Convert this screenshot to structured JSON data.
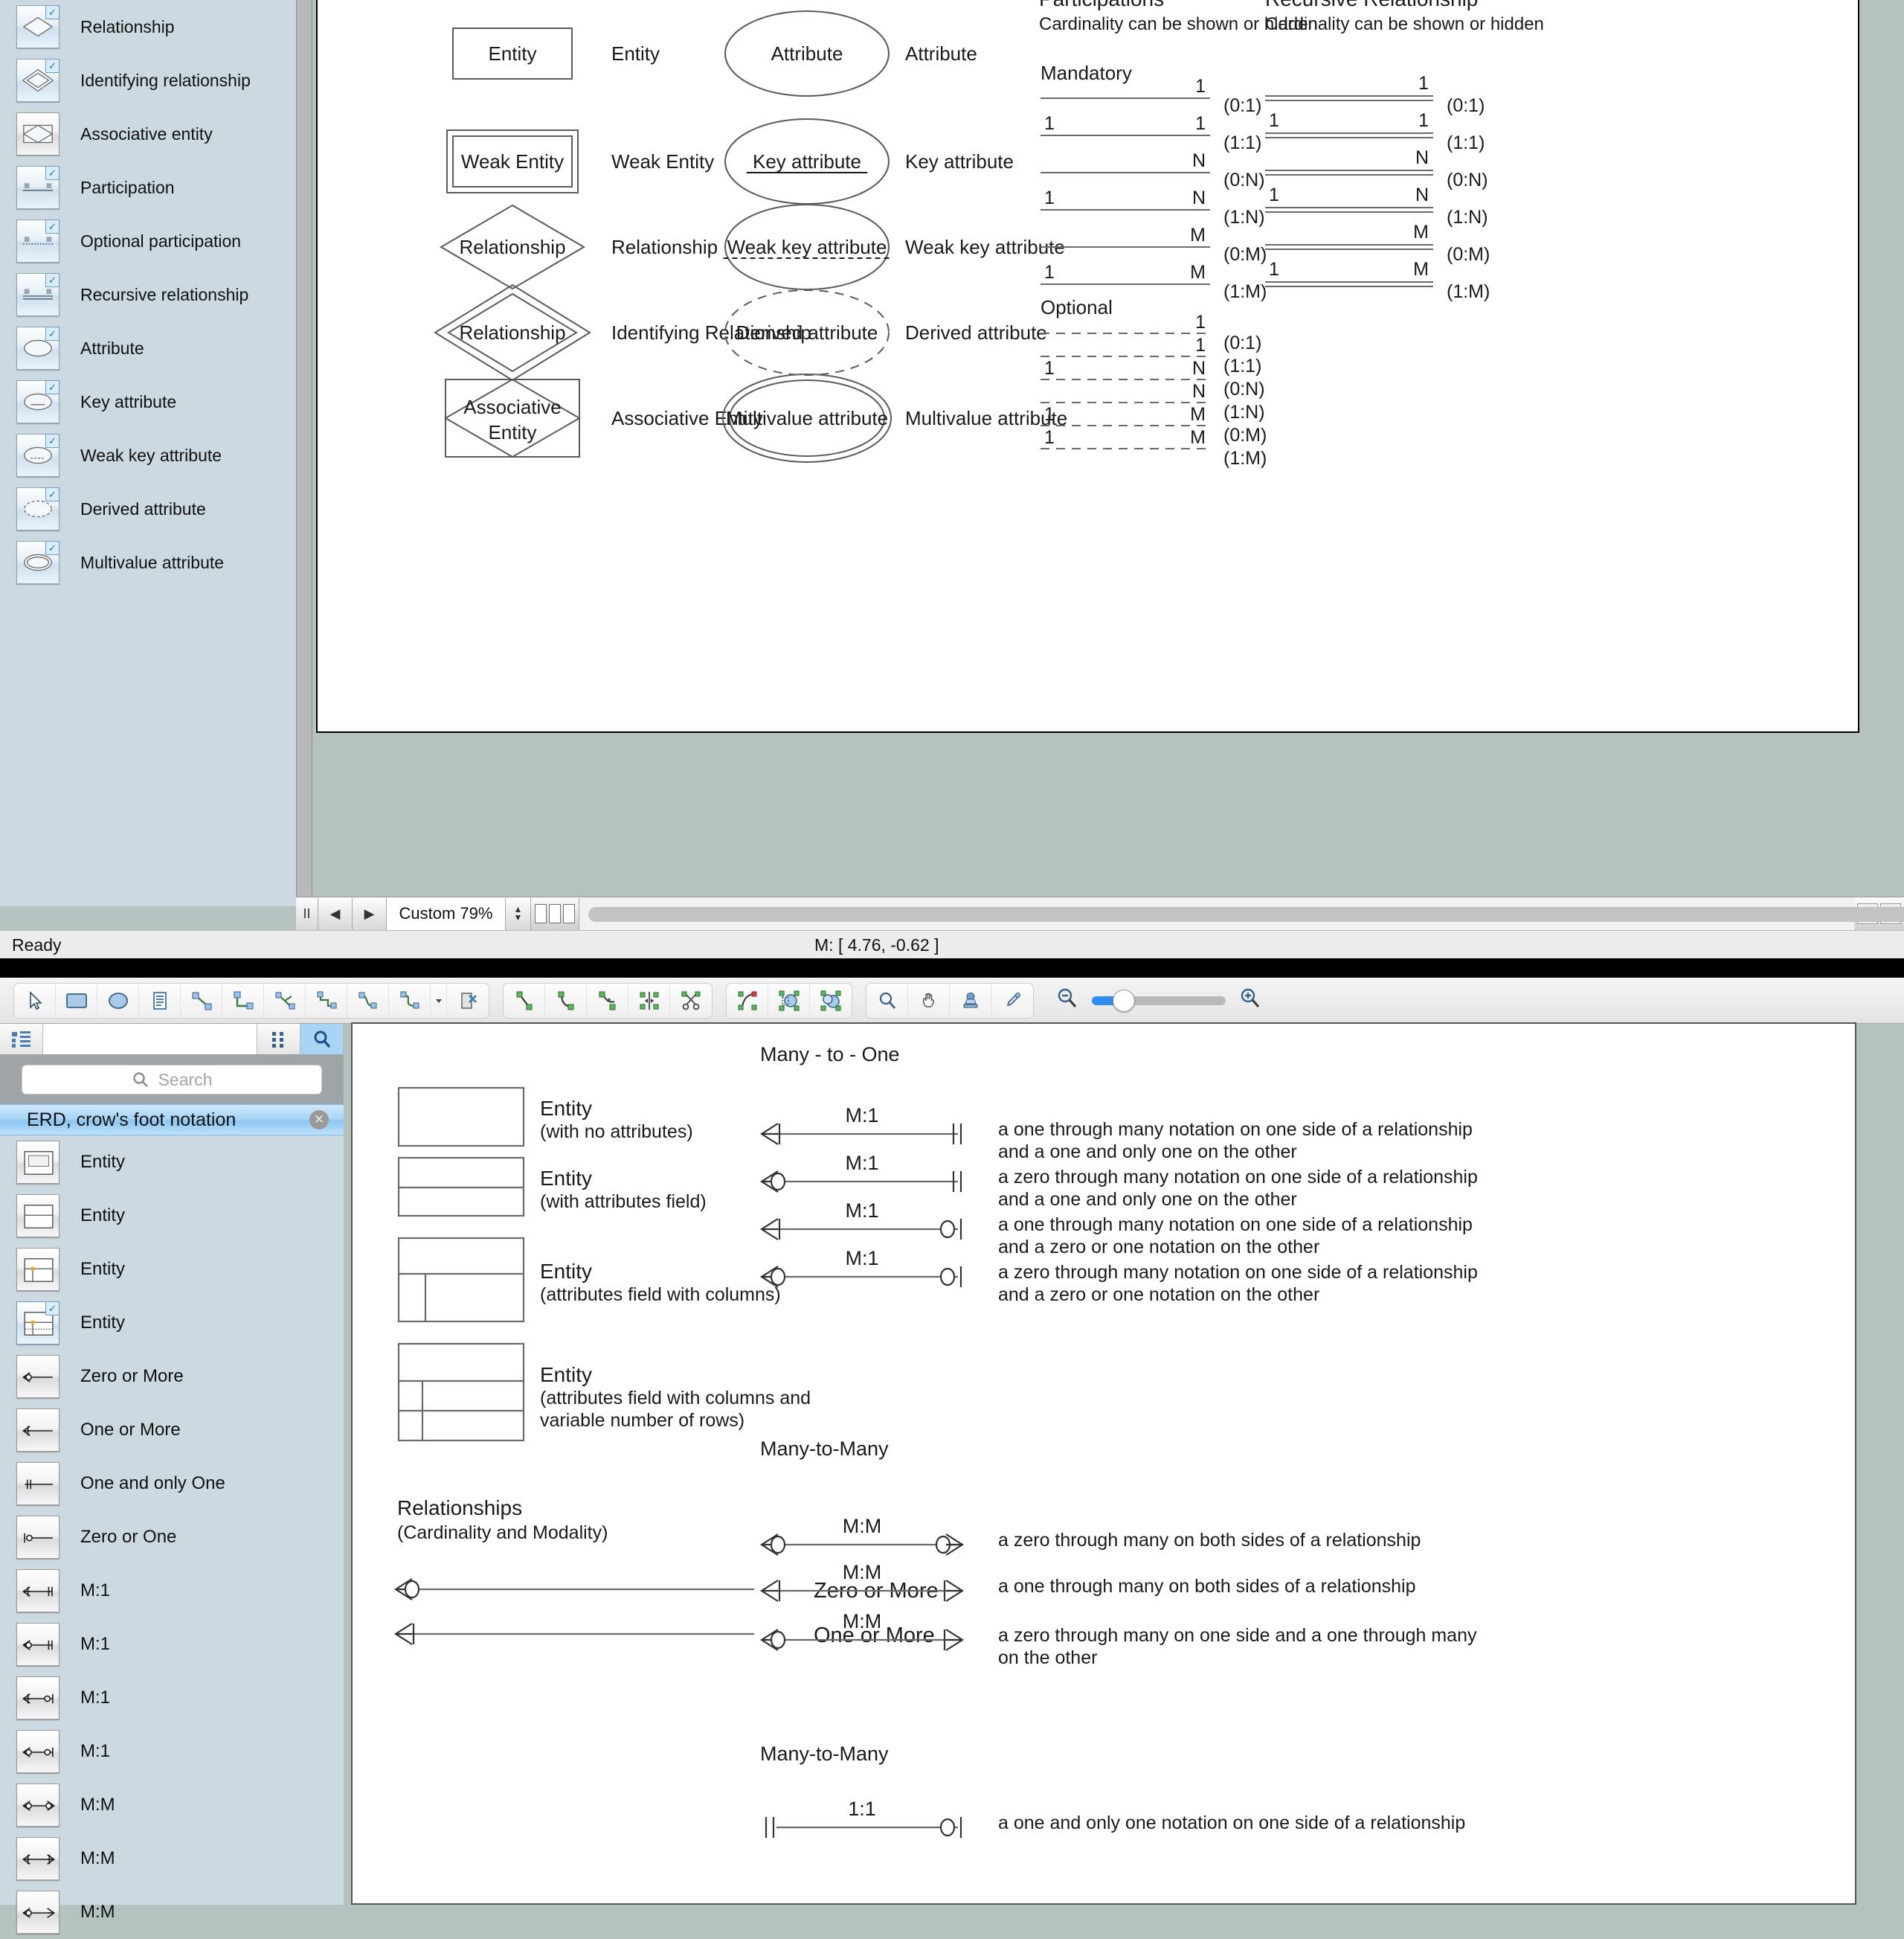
{
  "top_window": {
    "stencil_items": [
      {
        "label": "Relationship",
        "icon": "diamond-shape-icon",
        "checked": true
      },
      {
        "label": "Identifying relationship",
        "icon": "double-diamond-shape-icon",
        "checked": true
      },
      {
        "label": "Associative entity",
        "icon": "associative-entity-shape-icon",
        "checked": false
      },
      {
        "label": "Participation",
        "icon": "participation-line-icon",
        "checked": true
      },
      {
        "label": "Optional participation",
        "icon": "optional-participation-line-icon",
        "checked": true
      },
      {
        "label": "Recursive relationship",
        "icon": "recursive-relationship-line-icon",
        "checked": true
      },
      {
        "label": "Attribute",
        "icon": "ellipse-shape-icon",
        "checked": true
      },
      {
        "label": "Key attribute",
        "icon": "key-attribute-shape-icon",
        "checked": true
      },
      {
        "label": "Weak key attribute",
        "icon": "weak-key-attribute-shape-icon",
        "checked": true
      },
      {
        "label": "Derived attribute",
        "icon": "derived-attribute-shape-icon",
        "checked": true
      },
      {
        "label": "Multivalue attribute",
        "icon": "multivalue-attribute-shape-icon",
        "checked": true
      }
    ],
    "diagram": {
      "col1": [
        {
          "shape": "rectangle",
          "inner_text": "Entity",
          "caption": "Entity"
        },
        {
          "shape": "double-rectangle",
          "inner_text": "Weak Entity",
          "caption": "Weak Entity"
        },
        {
          "shape": "diamond",
          "inner_text": "Relationship",
          "caption": "Relationship"
        },
        {
          "shape": "double-diamond",
          "inner_text": "Relationship",
          "caption": "Identifying Relationship"
        },
        {
          "shape": "associative",
          "inner_text": "Associative Entity",
          "caption": "Associative Entity"
        }
      ],
      "col2": [
        {
          "shape": "ellipse",
          "inner_text": "Attribute",
          "caption": "Attribute"
        },
        {
          "shape": "ellipse-underline",
          "inner_text": "Key attribute",
          "caption": "Key attribute"
        },
        {
          "shape": "ellipse-dashed-underline",
          "inner_text": "Weak key attribute",
          "caption": "Weak key attribute"
        },
        {
          "shape": "ellipse-dashed",
          "inner_text": "Derived attribute",
          "caption": "Derived attribute"
        },
        {
          "shape": "double-ellipse",
          "inner_text": "Multivalue attribute",
          "caption": "Multivalue attribute"
        }
      ],
      "participations": {
        "title": "Participations",
        "subtitle": "Cardinality can be shown or hidden",
        "mandatory_label": "Mandatory",
        "optional_label": "Optional",
        "mandatory_rows": [
          {
            "left": "",
            "right": "1",
            "card": "(0:1)"
          },
          {
            "left": "1",
            "right": "1",
            "card": "(1:1)"
          },
          {
            "left": "",
            "right": "N",
            "card": "(0:N)"
          },
          {
            "left": "1",
            "right": "N",
            "card": "(1:N)"
          },
          {
            "left": "",
            "right": "M",
            "card": "(0:M)"
          },
          {
            "left": "1",
            "right": "M",
            "card": "(1:M)"
          }
        ],
        "optional_rows": [
          {
            "left": "",
            "right": "1",
            "card": "(0:1)"
          },
          {
            "left": "",
            "right": "1",
            "card": "(1:1)"
          },
          {
            "left": "1",
            "right": "N",
            "card": "(0:N)"
          },
          {
            "left": "",
            "right": "N",
            "card": "(1:N)"
          },
          {
            "left": "1",
            "right": "M",
            "card": "(0:M)"
          },
          {
            "left": "1",
            "right": "M",
            "card": "(1:M)"
          }
        ]
      },
      "recursive": {
        "title": "Recursive Relationship",
        "subtitle": "Cardinality can be shown or hidden",
        "rows": [
          {
            "left": "",
            "right": "1",
            "card": "(0:1)"
          },
          {
            "left": "1",
            "right": "1",
            "card": "(1:1)"
          },
          {
            "left": "",
            "right": "N",
            "card": "(0:N)"
          },
          {
            "left": "1",
            "right": "N",
            "card": "(1:N)"
          },
          {
            "left": "",
            "right": "M",
            "card": "(0:M)"
          },
          {
            "left": "1",
            "right": "M",
            "card": "(1:M)"
          }
        ]
      }
    },
    "hbar": {
      "pause_label": "II",
      "prev_label": "◀",
      "next_label": "▶",
      "zoom_value": "Custom 79%"
    },
    "status": {
      "ready": "Ready",
      "coords": "M: [ 4.76, -0.62 ]"
    }
  },
  "bottom_window": {
    "toolbar": {
      "groups": [
        {
          "buttons": [
            {
              "icon": "pointer-tool-icon"
            },
            {
              "icon": "rectangle-tool-icon"
            },
            {
              "icon": "ellipse-tool-icon"
            },
            {
              "icon": "text-block-tool-icon"
            },
            {
              "icon": "straight-connector-icon"
            },
            {
              "icon": "right-angle-connector-icon"
            },
            {
              "icon": "tree-connector-icon"
            },
            {
              "icon": "bus-connector-icon"
            },
            {
              "icon": "curve-connector-icon"
            },
            {
              "icon": "rounded-connector-icon"
            },
            {
              "icon": "connector-dropdown-icon"
            },
            {
              "icon": "delete-connector-icon"
            }
          ]
        },
        {
          "buttons": [
            {
              "icon": "line-segment-icon"
            },
            {
              "icon": "arc-segment-icon"
            },
            {
              "icon": "bezier-segment-icon"
            },
            {
              "icon": "mirror-icon"
            },
            {
              "icon": "scissors-icon"
            }
          ]
        },
        {
          "buttons": [
            {
              "icon": "edit-points-icon"
            },
            {
              "icon": "union-shapes-icon"
            },
            {
              "icon": "group-shapes-icon"
            }
          ]
        },
        {
          "buttons": [
            {
              "icon": "zoom-tool-icon"
            },
            {
              "icon": "hand-tool-icon"
            },
            {
              "icon": "stamp-tool-icon"
            },
            {
              "icon": "eyedropper-tool-icon"
            }
          ]
        }
      ],
      "zoom_out_icon": "zoom-out-icon",
      "zoom_in_icon": "zoom-in-icon"
    },
    "panel": {
      "tabs": [
        {
          "icon": "tree-view-icon",
          "active": false
        },
        {
          "icon": "grid-view-icon",
          "active": false
        },
        {
          "icon": "search-view-icon",
          "active": true
        }
      ],
      "search_placeholder": "Search",
      "search_value": "",
      "group_title": "ERD, crow's foot notation",
      "items": [
        {
          "label": "Entity",
          "icon": "entity-box-icon",
          "selected": false
        },
        {
          "label": "Entity",
          "icon": "entity-two-row-icon",
          "selected": false
        },
        {
          "label": "Entity",
          "icon": "entity-columns-icon",
          "selected": false
        },
        {
          "label": "Entity",
          "icon": "entity-variable-rows-icon",
          "selected": true
        },
        {
          "label": "Zero or More",
          "icon": "zero-or-more-icon",
          "selected": false
        },
        {
          "label": "One or More",
          "icon": "one-or-more-icon",
          "selected": false
        },
        {
          "label": "One and only One",
          "icon": "one-and-only-one-icon",
          "selected": false
        },
        {
          "label": "Zero or One",
          "icon": "zero-or-one-icon",
          "selected": false
        },
        {
          "label": "M:1",
          "icon": "m1-one-many-to-one-icon",
          "selected": false
        },
        {
          "label": "M:1",
          "icon": "m1-zero-many-to-one-icon",
          "selected": false
        },
        {
          "label": "M:1",
          "icon": "m1-one-many-to-zero-one-icon",
          "selected": false
        },
        {
          "label": "M:1",
          "icon": "m1-zero-many-to-zero-one-icon",
          "selected": false
        },
        {
          "label": "M:M",
          "icon": "mm-zero-many-both-icon",
          "selected": false
        },
        {
          "label": "M:M",
          "icon": "mm-one-many-both-icon",
          "selected": false
        },
        {
          "label": "M:M",
          "icon": "mm-zero-many-one-many-icon",
          "selected": false
        }
      ]
    },
    "diagram": {
      "entities": [
        {
          "caption": "Entity",
          "sub": "(with no attributes)",
          "style": "plain"
        },
        {
          "caption": "Entity",
          "sub": "(with attributes field)",
          "style": "two-row"
        },
        {
          "caption": "Entity",
          "sub": "(attributes field with columns)",
          "style": "columns"
        },
        {
          "caption": "Entity",
          "sub": "(attributes field with columns and",
          "sub2": "variable number of rows)",
          "style": "variable-rows"
        }
      ],
      "relationships_title": "Relationships",
      "relationships_sub": "(Cardinality and Modality)",
      "cardinality_rows": [
        {
          "label": "Zero or More",
          "left": "crowfoot-circle",
          "right": "none"
        },
        {
          "label": "One or More",
          "left": "crowfoot-bar",
          "right": "none"
        }
      ],
      "sections": [
        {
          "title": "Many - to - One",
          "rows": [
            {
              "card": "M:1",
              "left": "crowfoot-bar",
              "right": "double-bar",
              "desc1": "a one through many notation on one side of a relationship",
              "desc2": "and a one and only one on the other"
            },
            {
              "card": "M:1",
              "left": "crowfoot-circle",
              "right": "double-bar",
              "desc1": "a zero through many notation on one side of a relationship",
              "desc2": "and a one and only one on the other"
            },
            {
              "card": "M:1",
              "left": "crowfoot-bar",
              "right": "circle-bar",
              "desc1": "a one through many notation on one side of a relationship",
              "desc2": "and a zero or one notation on the other"
            },
            {
              "card": "M:1",
              "left": "crowfoot-circle",
              "right": "circle-bar",
              "desc1": "a zero through many notation on one side of a relationship",
              "desc2": "and a zero or one notation on the other"
            }
          ]
        },
        {
          "title": "Many-to-Many",
          "rows": [
            {
              "card": "M:M",
              "left": "crowfoot-circle",
              "right": "circle-crowfoot",
              "desc1": "a zero through many on both sides of a relationship",
              "desc2": ""
            },
            {
              "card": "M:M",
              "left": "crowfoot-bar",
              "right": "bar-crowfoot",
              "desc1": "a one through many on both sides of a relationship",
              "desc2": ""
            },
            {
              "card": "M:M",
              "left": "crowfoot-circle",
              "right": "bar-crowfoot",
              "desc1": "a zero through many on one side and a one through many",
              "desc2": "on the other"
            }
          ]
        },
        {
          "title": "Many-to-Many",
          "rows": [
            {
              "card": "1:1",
              "left": "double-bar",
              "right": "circle-bar",
              "desc1": "a one and only one notation on one side of a relationship",
              "desc2": ""
            }
          ]
        }
      ]
    }
  }
}
